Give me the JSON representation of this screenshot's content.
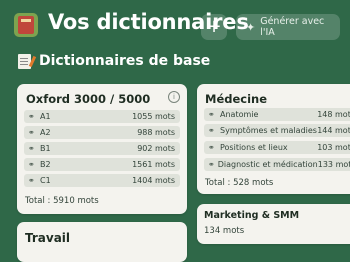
{
  "header": {
    "title": "Vos dictionnaires",
    "add_label": "+",
    "ai_button_label": "Générer avec l'IA"
  },
  "section": {
    "title": "Dictionnaires de base"
  },
  "cards": {
    "oxford": {
      "title": "Oxford 3000 / 5000",
      "items": [
        {
          "label": "A1",
          "count": "1055 mots"
        },
        {
          "label": "A2",
          "count": "988 mots"
        },
        {
          "label": "B1",
          "count": "902 mots"
        },
        {
          "label": "B2",
          "count": "1561 mots"
        },
        {
          "label": "C1",
          "count": "1404 mots"
        }
      ],
      "total": "Total : 5910 mots"
    },
    "medecine": {
      "title": "Médecine",
      "items": [
        {
          "label": "Anatomie",
          "count": "148 mots"
        },
        {
          "label": "Symptômes et maladies",
          "count": "144 mots"
        },
        {
          "label": "Positions et lieux",
          "count": "103 mots"
        },
        {
          "label": "Diagnostic et médication",
          "count": "133 mots"
        }
      ],
      "total": "Total : 528 mots"
    },
    "marketing": {
      "title": "Marketing & SMM",
      "subtitle": "134 mots"
    },
    "travail": {
      "title": "Travail"
    }
  },
  "icons": {
    "app": "books-icon",
    "section": "memo-icon",
    "row": "link-icon",
    "info": "info-icon",
    "ai": "sparkle-icon"
  }
}
